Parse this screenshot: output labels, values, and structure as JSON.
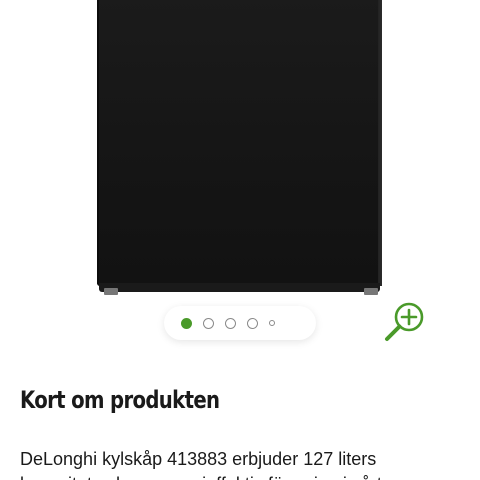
{
  "product": {
    "image_alt": "DeLonghi kylskåp 413883",
    "carousel": {
      "total_slides": 5,
      "active_index": 0
    },
    "zoom_icon": "zoom-in-icon"
  },
  "section": {
    "title": "Kort om produkten",
    "description_line1": "DeLonghi kylskåp 413883 erbjuder 127 liters",
    "description_line2": "kapacitet och en energieffektiv förvaring i vårt"
  },
  "colors": {
    "accent": "#4a9a2a",
    "text": "#1a1a1a",
    "fridge": "#151515"
  }
}
